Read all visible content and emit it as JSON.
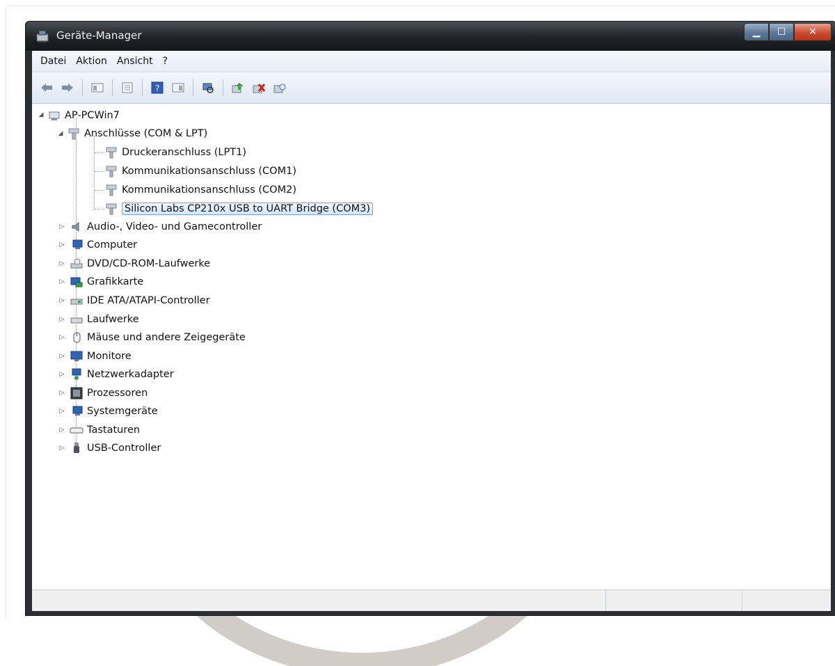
{
  "window": {
    "title": "Geräte-Manager"
  },
  "menu": [
    "Datei",
    "Aktion",
    "Ansicht",
    "?"
  ],
  "toolbar": {
    "icons": [
      "back-icon",
      "forward-icon",
      "show-hide-console-tree-icon",
      "properties-icon",
      "help-icon",
      "action-pane-icon",
      "scan-hardware-icon",
      "update-driver-icon",
      "uninstall-icon",
      "disable-icon"
    ]
  },
  "tree": {
    "root": "AP-PCWin7",
    "categories": [
      {
        "label": "Anschlüsse (COM & LPT)",
        "expanded": true,
        "icon": "port-icon",
        "children": [
          "Druckeranschluss (LPT1)",
          "Kommunikationsanschluss (COM1)",
          "Kommunikationsanschluss (COM2)",
          "Silicon Labs CP210x USB to UART Bridge (COM3)"
        ],
        "selected_child": 3
      },
      {
        "label": "Audio-, Video- und Gamecontroller",
        "icon": "speaker-icon"
      },
      {
        "label": "Computer",
        "icon": "computer-icon"
      },
      {
        "label": "DVD/CD-ROM-Laufwerke",
        "icon": "dvd-drive-icon"
      },
      {
        "label": "Grafikkarte",
        "icon": "display-adapter-icon"
      },
      {
        "label": "IDE ATA/ATAPI-Controller",
        "icon": "ide-controller-icon"
      },
      {
        "label": "Laufwerke",
        "icon": "disk-drive-icon"
      },
      {
        "label": "Mäuse und andere Zeigegeräte",
        "icon": "mouse-icon"
      },
      {
        "label": "Monitore",
        "icon": "monitor-icon"
      },
      {
        "label": "Netzwerkadapter",
        "icon": "network-adapter-icon"
      },
      {
        "label": "Prozessoren",
        "icon": "processor-icon"
      },
      {
        "label": "Systemgeräte",
        "icon": "system-device-icon"
      },
      {
        "label": "Tastaturen",
        "icon": "keyboard-icon"
      },
      {
        "label": "USB-Controller",
        "icon": "usb-icon"
      }
    ]
  },
  "colors": {
    "titlebar": "#1f2226",
    "selection_border": "#7da2ce",
    "watermark_grey": "#c9c4bc",
    "watermark_blue": "#c7d2e6"
  }
}
